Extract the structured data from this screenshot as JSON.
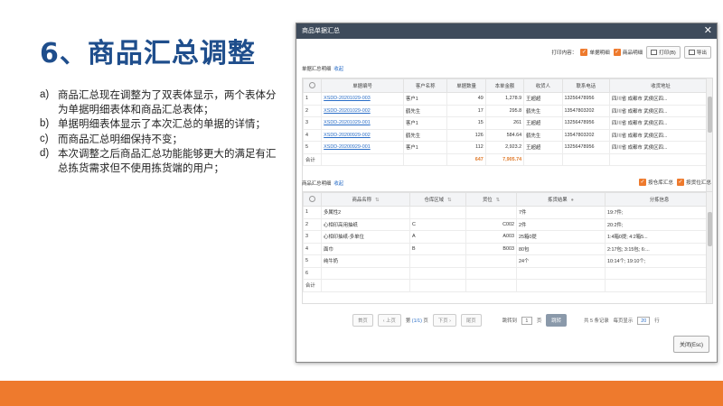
{
  "slide": {
    "title": "6、商品汇总调整",
    "bullets": [
      {
        "marker": "a)",
        "text": "商品汇总现在调整为了双表体显示，两个表体分为单据明细表体和商品汇总表体；"
      },
      {
        "marker": "b)",
        "text": "单据明细表体显示了本次汇总的单据的详情；"
      },
      {
        "marker": "c)",
        "text": "而商品汇总明细保持不变；"
      },
      {
        "marker": "d)",
        "text": "本次调整之后商品汇总功能能够更大的满足有汇总拣货需求但不使用拣货端的用户；"
      }
    ]
  },
  "dialog": {
    "title": "商品单据汇总",
    "close_glyph": "✕",
    "print_content_label": "打印内容：",
    "opt_doc_detail": "单据明细",
    "opt_goods_detail": "商品明细",
    "print_btn": "打印(B)",
    "export_btn": "导出",
    "section1_label": "单据汇总明细",
    "section1_link": "收起",
    "section2_label": "商品汇总明细",
    "section2_link": "收起",
    "opt_by_warehouse": "按仓库汇总",
    "opt_by_location": "按货位汇总",
    "close_btn": "关闭(Esc)"
  },
  "doc_table": {
    "headers": [
      "",
      "单据编号",
      "客户名称",
      "单据数量",
      "本单金额",
      "收货人",
      "联系电话",
      "收货地址"
    ],
    "rows": [
      [
        "1",
        "XSDD-20201029-003",
        "客户1",
        "49",
        "1,278.9",
        "王超超",
        "13256478956",
        "四川省 成都市 武侯区四..."
      ],
      [
        "2",
        "XSDD-20201029-002",
        "鹤先生",
        "17",
        "295.8",
        "鹤先生",
        "13547803202",
        "四川省 成都市 武侯区四..."
      ],
      [
        "3",
        "XSDD-20201029-001",
        "客户1",
        "15",
        "261",
        "王超超",
        "13256478956",
        "四川省 成都市 武侯区四..."
      ],
      [
        "4",
        "XSDD-20200929-002",
        "鹤先生",
        "126",
        "584.64",
        "鹤先生",
        "13547803202",
        "四川省 成都市 武侯区四..."
      ],
      [
        "5",
        "XSDD-20200929-001",
        "客户1",
        "112",
        "2,923.2",
        "王超超",
        "13256478956",
        "四川省 成都市 武侯区四..."
      ]
    ],
    "total_label": "合计",
    "total_qty": "647",
    "total_amount": "7,905.74"
  },
  "goods_table": {
    "headers": [
      "",
      "商品名称",
      "仓库区域",
      "货位",
      "拣货结果",
      "分拣信息"
    ],
    "rows": [
      [
        "1",
        "多属性2",
        "",
        "",
        "7件",
        "19:7件;"
      ],
      [
        "2",
        "心相印高用抽纸",
        "C",
        "C002",
        "2件",
        "20:2件;"
      ],
      [
        "3",
        "心相印抽纸-多单位",
        "A",
        "A003",
        "25箱0提",
        "1:4箱0提; 4:2箱5..."
      ],
      [
        "4",
        "面巾",
        "B",
        "B003",
        "80包",
        "2:17包; 3:15包; 6:..."
      ],
      [
        "5",
        "纯牛奶",
        "",
        "",
        "24个",
        "10:14个; 19:10个;"
      ],
      [
        "6",
        "",
        "",
        "",
        "",
        ""
      ]
    ],
    "total_label": "合计"
  },
  "pager": {
    "first": "首页",
    "prev": "上页",
    "page_prefix": "第",
    "page_info": "(1/1)",
    "page_suffix": "页",
    "next": "下页",
    "last": "尾页",
    "jump_label": "跳转到",
    "jump_value": "1",
    "jump_unit": "页",
    "go": "跳转",
    "total_text": "共 5 条记录",
    "per_page_label": "每页显示",
    "per_page_value": "20",
    "per_page_unit": "行"
  },
  "colors": {
    "title": "#1f4e8c",
    "accent": "#ee7a2d",
    "link": "#2a6ec7",
    "dialog_header": "#3e4b5b"
  }
}
